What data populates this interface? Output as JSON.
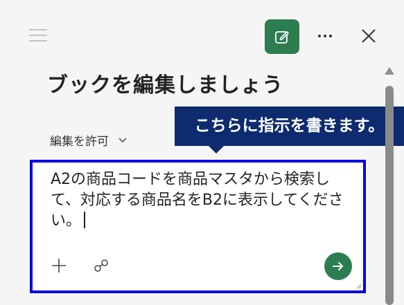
{
  "header": {
    "menu_icon": "hamburger-icon",
    "edit_icon": "edit-icon",
    "more_icon": "more-horizontal-icon",
    "close_icon": "close-icon"
  },
  "main": {
    "title": "ブックを編集しましょう",
    "permission_label": "編集を許可",
    "permission_chevron": "chevron-down-icon"
  },
  "callout": {
    "text": "こちらに指示を書きます。",
    "color": "#0d2b6e"
  },
  "prompt": {
    "value": "A2の商品コードを商品マスタから検索して、対応する商品名をB2に表示してください。",
    "add_icon": "plus-icon",
    "attach_icon": "link-icon",
    "send_icon": "send-arrow-icon",
    "border_color": "#0000e6"
  },
  "colors": {
    "accent": "#2c7d4f",
    "background": "#f5f5f5"
  }
}
